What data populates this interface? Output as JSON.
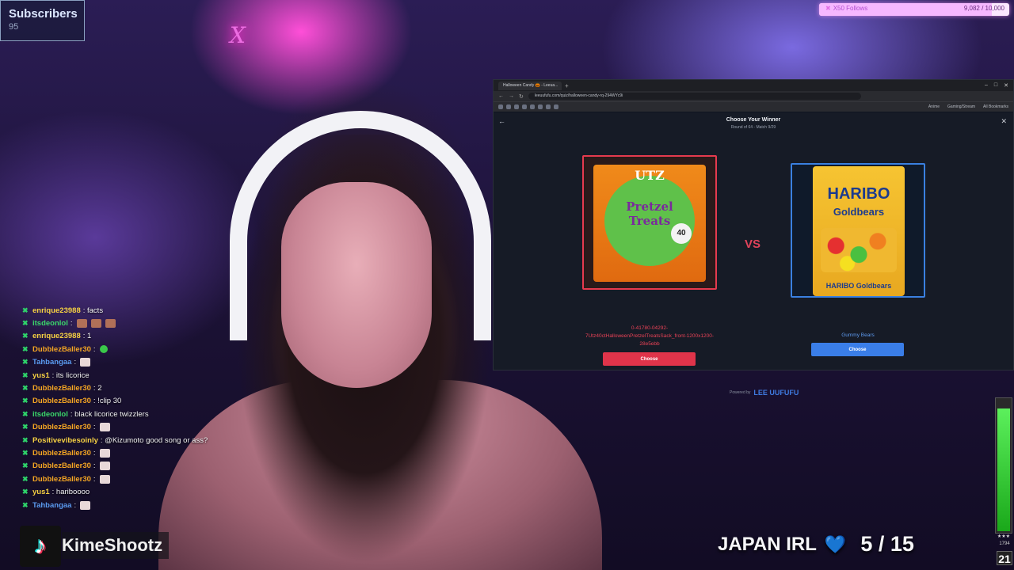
{
  "subscribers": {
    "title": "Subscribers",
    "count": "95"
  },
  "follow_goal": {
    "label": "X50 Follows",
    "count": "9,082 / 10,000",
    "progress_fraction": 0.908
  },
  "browser": {
    "tab_title": "Halloween Candy 🎃 - Leeua...",
    "url": "leeuufufu.com/quiz/halloween-candy-rq-294WYc9i",
    "bookmark_labels": [
      "Anime",
      "Gaming/Stream",
      "All Bookmarks"
    ],
    "page": {
      "title": "Choose Your Winner",
      "subtitle": "Round of 64 - Match 9/29",
      "vs_label": "VS",
      "left": {
        "brand": "UTZ",
        "product": "Pretzel Treats",
        "badge": "40",
        "caption": "0-41780-04292-7Utz40ctHalloweenPretzelTreatsSack_front-1200x1200-28e5ebb",
        "button": "Choose"
      },
      "right": {
        "brand": "HARIBO",
        "product": "Goldbears",
        "foot": "HARIBO Goldbears",
        "caption": "Gummy Bears",
        "button": "Choose"
      },
      "powered_by": "Powered by",
      "powered_logo": "LEE UUFUFU"
    }
  },
  "chat": [
    {
      "user": "enrique23988",
      "color": "#f5d042",
      "text": ": facts",
      "emotes": []
    },
    {
      "user": "itsdeonlol",
      "color": "#3ad86a",
      "text": ":",
      "emotes": [
        "brown",
        "brown",
        "brown"
      ]
    },
    {
      "user": "enrique23988",
      "color": "#f5d042",
      "text": ": 1",
      "emotes": []
    },
    {
      "user": "DubblezBaller30",
      "color": "#f5a623",
      "text": ":",
      "emotes": [
        "green"
      ]
    },
    {
      "user": "Tahbangaa",
      "color": "#5a9bf0",
      "text": ":",
      "emotes": [
        "white"
      ]
    },
    {
      "user": "yus1",
      "color": "#f5d042",
      "text": ": its licorice",
      "emotes": []
    },
    {
      "user": "DubblezBaller30",
      "color": "#f5a623",
      "text": ": 2",
      "emotes": []
    },
    {
      "user": "DubblezBaller30",
      "color": "#f5a623",
      "text": ": !clip 30",
      "emotes": []
    },
    {
      "user": "itsdeonlol",
      "color": "#3ad86a",
      "text": ": black licorice twizzlers",
      "emotes": []
    },
    {
      "user": "DubblezBaller30",
      "color": "#f5a623",
      "text": ":",
      "emotes": [
        "white"
      ]
    },
    {
      "user": "Positivevibesoinly",
      "color": "#f5d042",
      "text": ": @Kizumoto good song or ass?",
      "emotes": []
    },
    {
      "user": "DubblezBaller30",
      "color": "#f5a623",
      "text": ":",
      "emotes": [
        "white"
      ]
    },
    {
      "user": "DubblezBaller30",
      "color": "#f5a623",
      "text": ":",
      "emotes": [
        "white"
      ]
    },
    {
      "user": "DubblezBaller30",
      "color": "#f5a623",
      "text": ":",
      "emotes": [
        "white"
      ]
    },
    {
      "user": "yus1",
      "color": "#f5d042",
      "text": ": hariboooo",
      "emotes": []
    },
    {
      "user": "Tahbangaa",
      "color": "#5a9bf0",
      "text": ":",
      "emotes": [
        "white"
      ]
    }
  ],
  "streamer_tag": "KimeShootz",
  "irl_overlay": {
    "label": "JAPAN IRL",
    "heart": "💙",
    "count": "5 / 15"
  },
  "audio_meter": {
    "level_fraction": 0.92,
    "stars": "★★★",
    "mini": "1794",
    "box": "21"
  },
  "colors": {
    "accent_red": "#e0344a",
    "accent_blue": "#3a7ee8"
  }
}
